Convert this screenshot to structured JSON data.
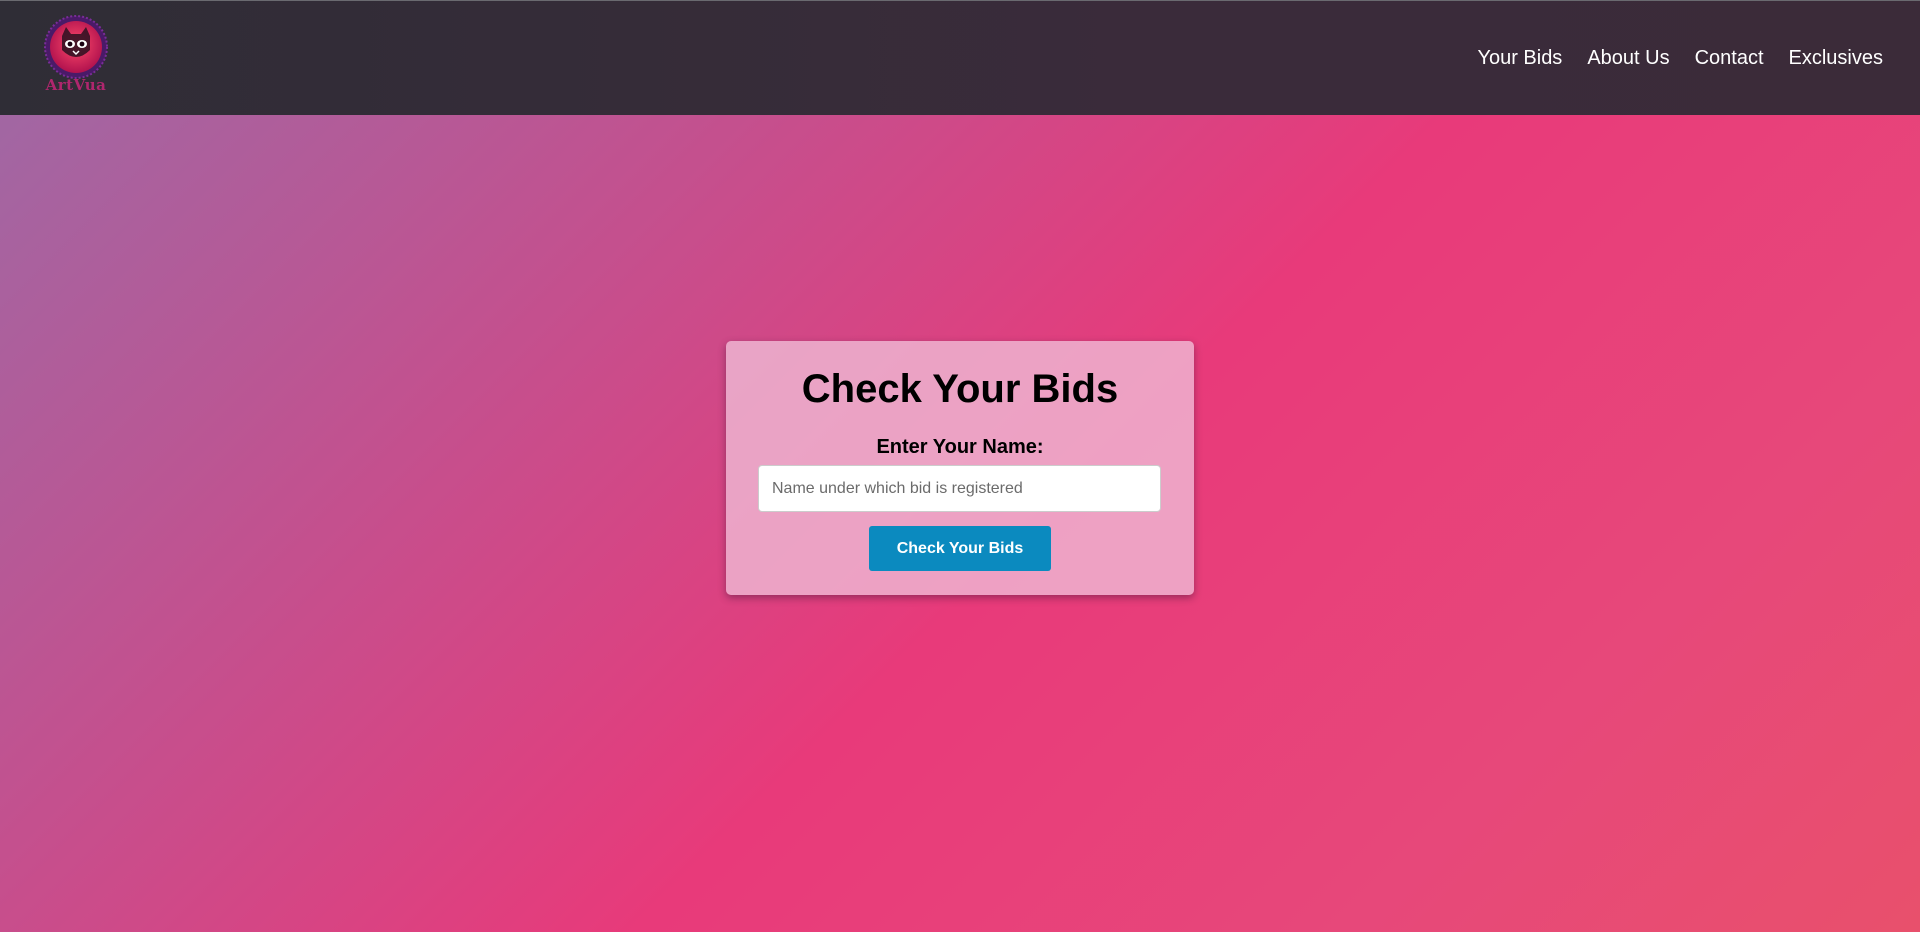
{
  "brand": {
    "logo_text": "ArtVua",
    "logo_icon": "cat-skull-badge-icon"
  },
  "nav": {
    "links": [
      {
        "label": "Your Bids"
      },
      {
        "label": "About Us"
      },
      {
        "label": "Contact"
      },
      {
        "label": "Exclusives"
      }
    ]
  },
  "card": {
    "title": "Check Your Bids",
    "label": "Enter Your Name:",
    "input": {
      "value": "",
      "placeholder": "Name under which bid is registered"
    },
    "button_label": "Check Your Bids"
  },
  "colors": {
    "button": "#0b8abf",
    "navbar": "#33303a",
    "accent_pink": "#e83a7a"
  }
}
